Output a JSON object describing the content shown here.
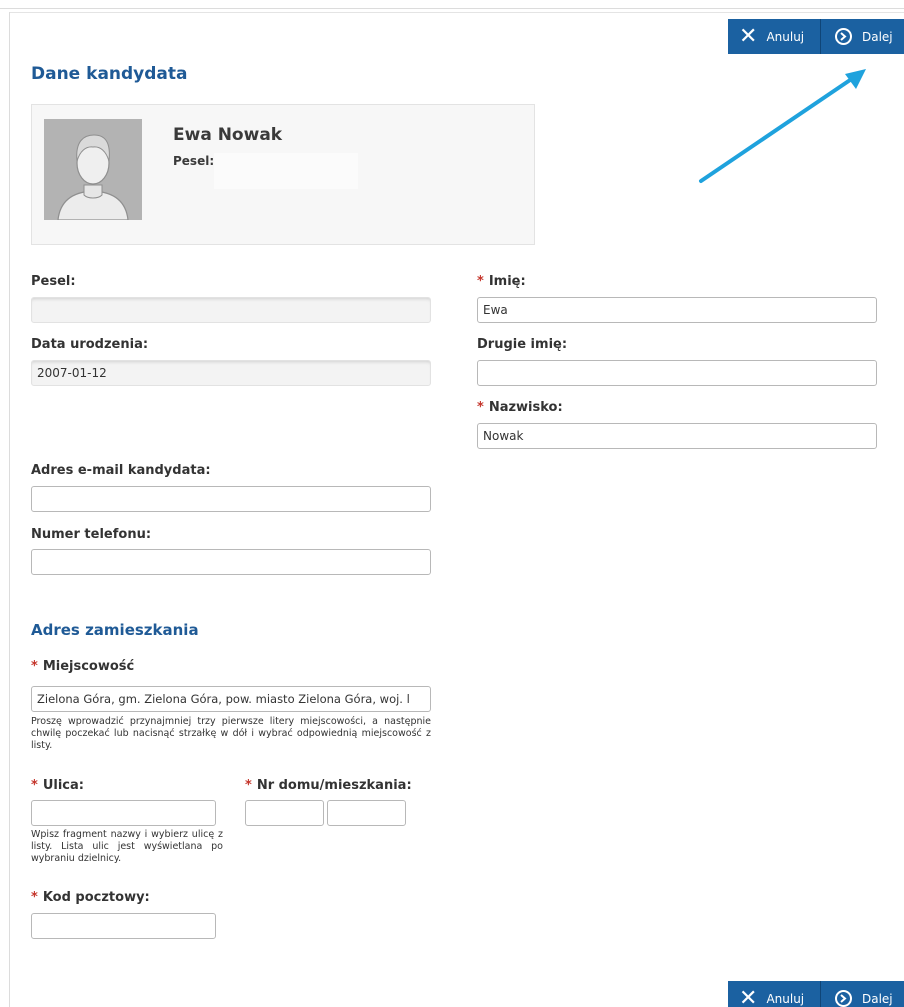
{
  "toolbar": {
    "cancel_label": "Anuluj",
    "next_label": "Dalej",
    "accent": "#1b61a1"
  },
  "candidate_section": {
    "title": "Dane kandydata"
  },
  "profile": {
    "name": "Ewa Nowak",
    "pesel_label": "Pesel:",
    "pesel_value": ""
  },
  "fields": {
    "pesel": {
      "label": "Pesel:",
      "value": ""
    },
    "birth_date": {
      "label": "Data urodzenia:",
      "value": "2007-01-12"
    },
    "first_name": {
      "label": "Imię:",
      "value": "Ewa",
      "required": true
    },
    "second_name": {
      "label": "Drugie imię:",
      "value": ""
    },
    "last_name": {
      "label": "Nazwisko:",
      "value": "Nowak",
      "required": true
    },
    "email": {
      "label": "Adres e-mail kandydata:",
      "value": ""
    },
    "phone": {
      "label": "Numer telefonu:",
      "value": ""
    }
  },
  "address_section": {
    "title": "Adres zamieszkania",
    "city": {
      "label": "Miejscowość",
      "value": "Zielona Góra, gm. Zielona Góra, pow. miasto Zielona Góra, woj. l",
      "hint": "Proszę wprowadzić przynajmniej trzy pierwsze litery miejscowości, a następnie chwilę poczekać lub nacisnąć strzałkę w dół i wybrać odpowiednią miejscowość z listy."
    },
    "street": {
      "label": "Ulica:",
      "value": "",
      "hint": "Wpisz fragment nazwy i wybierz ulicę z listy. Lista ulic jest wyświetlana po wybraniu dzielnicy."
    },
    "house_number": {
      "label": "Nr domu/mieszkania:",
      "house_value": "",
      "flat_value": ""
    },
    "postal_code": {
      "label": "Kod pocztowy:",
      "value": ""
    }
  },
  "annotation": {
    "arrow_color": "#1fa2dd"
  }
}
